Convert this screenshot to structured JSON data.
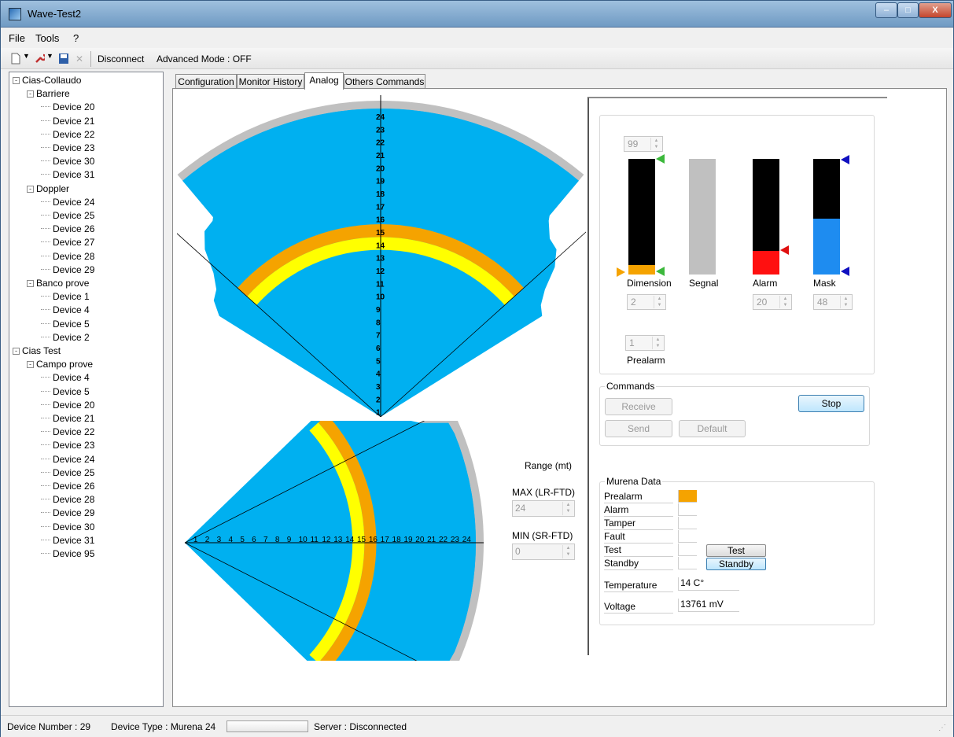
{
  "window": {
    "title": "Wave-Test2",
    "min": "–",
    "max": "□",
    "close": "X"
  },
  "menu": [
    "File",
    "Tools",
    "?"
  ],
  "toolbar": {
    "disconnect": "Disconnect",
    "advanced_mode": "Advanced Mode : OFF"
  },
  "tree": [
    {
      "label": "Cias-Collaudo",
      "level": 0,
      "expander": "-"
    },
    {
      "label": "Barriere",
      "level": 1,
      "expander": "-"
    },
    {
      "label": "Device 20",
      "level": 2
    },
    {
      "label": "Device 21",
      "level": 2
    },
    {
      "label": "Device 22",
      "level": 2
    },
    {
      "label": "Device 23",
      "level": 2
    },
    {
      "label": "Device 30",
      "level": 2
    },
    {
      "label": "Device 31",
      "level": 2
    },
    {
      "label": "Doppler",
      "level": 1,
      "expander": "-"
    },
    {
      "label": "Device 24",
      "level": 2
    },
    {
      "label": "Device 25",
      "level": 2
    },
    {
      "label": "Device 26",
      "level": 2
    },
    {
      "label": "Device 27",
      "level": 2
    },
    {
      "label": "Device 28",
      "level": 2
    },
    {
      "label": "Device 29",
      "level": 2
    },
    {
      "label": "Banco prove",
      "level": 1,
      "expander": "-"
    },
    {
      "label": "Device 1",
      "level": 2
    },
    {
      "label": "Device 4",
      "level": 2
    },
    {
      "label": "Device 5",
      "level": 2
    },
    {
      "label": "Device 2",
      "level": 2
    },
    {
      "label": "Cias Test",
      "level": 0,
      "expander": "-"
    },
    {
      "label": "Campo prove",
      "level": 1,
      "expander": "-"
    },
    {
      "label": "Device 4",
      "level": 2
    },
    {
      "label": "Device 5",
      "level": 2
    },
    {
      "label": "Device 20",
      "level": 2
    },
    {
      "label": "Device 21",
      "level": 2
    },
    {
      "label": "Device 22",
      "level": 2
    },
    {
      "label": "Device 23",
      "level": 2
    },
    {
      "label": "Device 24",
      "level": 2
    },
    {
      "label": "Device 25",
      "level": 2
    },
    {
      "label": "Device 26",
      "level": 2
    },
    {
      "label": "Device 28",
      "level": 2
    },
    {
      "label": "Device 29",
      "level": 2
    },
    {
      "label": "Device 30",
      "level": 2
    },
    {
      "label": "Device 31",
      "level": 2
    },
    {
      "label": "Device 95",
      "level": 2
    }
  ],
  "tabs": [
    "Configuration",
    "Monitor History",
    "Analog",
    "Others Commands"
  ],
  "active_tab": "Analog",
  "radar": {
    "ticks": [
      "1",
      "2",
      "3",
      "4",
      "5",
      "6",
      "7",
      "8",
      "9",
      "10",
      "11",
      "12",
      "13",
      "14",
      "15",
      "16",
      "17",
      "18",
      "19",
      "20",
      "21",
      "22",
      "23",
      "24"
    ],
    "max_range": 24,
    "yellow_band": [
      13,
      14
    ],
    "orange_band": [
      14,
      15
    ],
    "colors": {
      "field": "#00b0f0",
      "yellow": "#ffff00",
      "orange": "#f5a300",
      "rim": "#c0c0c0"
    }
  },
  "range": {
    "title": "Range (mt)",
    "max_label": "MAX (LR-FTD)",
    "max_value": "24",
    "min_label": "MIN (SR-FTD)",
    "min_value": "0"
  },
  "levels": {
    "top_spin": "99",
    "dimension_label": "Dimension",
    "dimension_value": "2",
    "dimension_level": 2,
    "segnal_label": "Segnal",
    "alarm_label": "Alarm",
    "alarm_value": "20",
    "alarm_level": 20,
    "mask_label": "Mask",
    "mask_value": "48",
    "mask_level": 48,
    "prealarm_label": "Prealarm",
    "prealarm_value": "1"
  },
  "commands": {
    "title": "Commands",
    "receive": "Receive",
    "send": "Send",
    "default": "Default",
    "stop": "Stop"
  },
  "murena": {
    "title": "Murena Data",
    "prealarm": "Prealarm",
    "alarm": "Alarm",
    "tamper": "Tamper",
    "fault": "Fault",
    "test": "Test",
    "standby": "Standby",
    "test_button": "Test",
    "standby_button": "Standby",
    "temperature_label": "Temperature",
    "temperature_value": "14 C°",
    "voltage_label": "Voltage",
    "voltage_value": "13761 mV",
    "prealarm_color": "#f5a300"
  },
  "status": {
    "device_number": "Device Number :  29",
    "device_type": "Device Type : Murena 24",
    "server": "Server : Disconnected"
  }
}
